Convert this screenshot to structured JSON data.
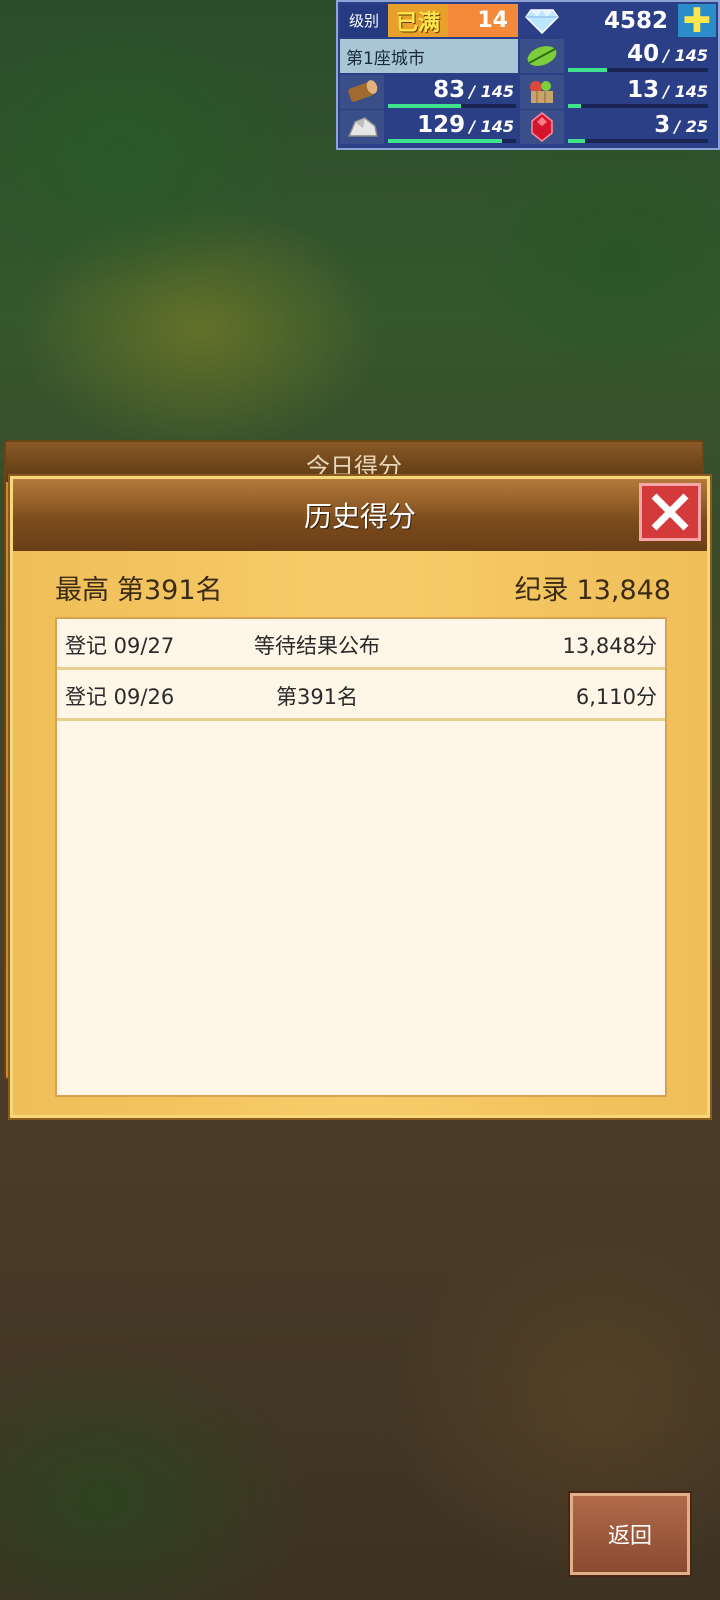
{
  "hud": {
    "level_label": "级别",
    "level_max_badge": "已满",
    "level": "14",
    "gems": "4582",
    "city_name": "第1座城市",
    "resources": [
      {
        "icon": "leaf-icon",
        "value": "40",
        "max": "/ 145",
        "fill": 0.28
      },
      {
        "icon": "wood-log-icon",
        "value": "83",
        "max": "/ 145",
        "fill": 0.57
      },
      {
        "icon": "food-basket-icon",
        "value": "13",
        "max": "/ 145",
        "fill": 0.09
      },
      {
        "icon": "stone-ore-icon",
        "value": "129",
        "max": "/ 145",
        "fill": 0.89
      },
      {
        "icon": "ruby-icon",
        "value": "3",
        "max": "/ 25",
        "fill": 0.12
      }
    ],
    "accent_colors": {
      "hud_bg": "#2b3f86",
      "bar_fill": "#3fe38c",
      "level_orange": "#f28a3a"
    }
  },
  "back_panel_title": "今日得分",
  "dialog": {
    "title": "历史得分",
    "best_label": "最高",
    "best_rank": "第391名",
    "record_label": "纪录",
    "record_value": "13,848",
    "entries": [
      {
        "date": "登记 09/27",
        "status": "等待结果公布",
        "score": "13,848分"
      },
      {
        "date": "登记 09/26",
        "status": "第391名",
        "score": "6,110分"
      }
    ]
  },
  "footer": {
    "back_label": "返回"
  }
}
